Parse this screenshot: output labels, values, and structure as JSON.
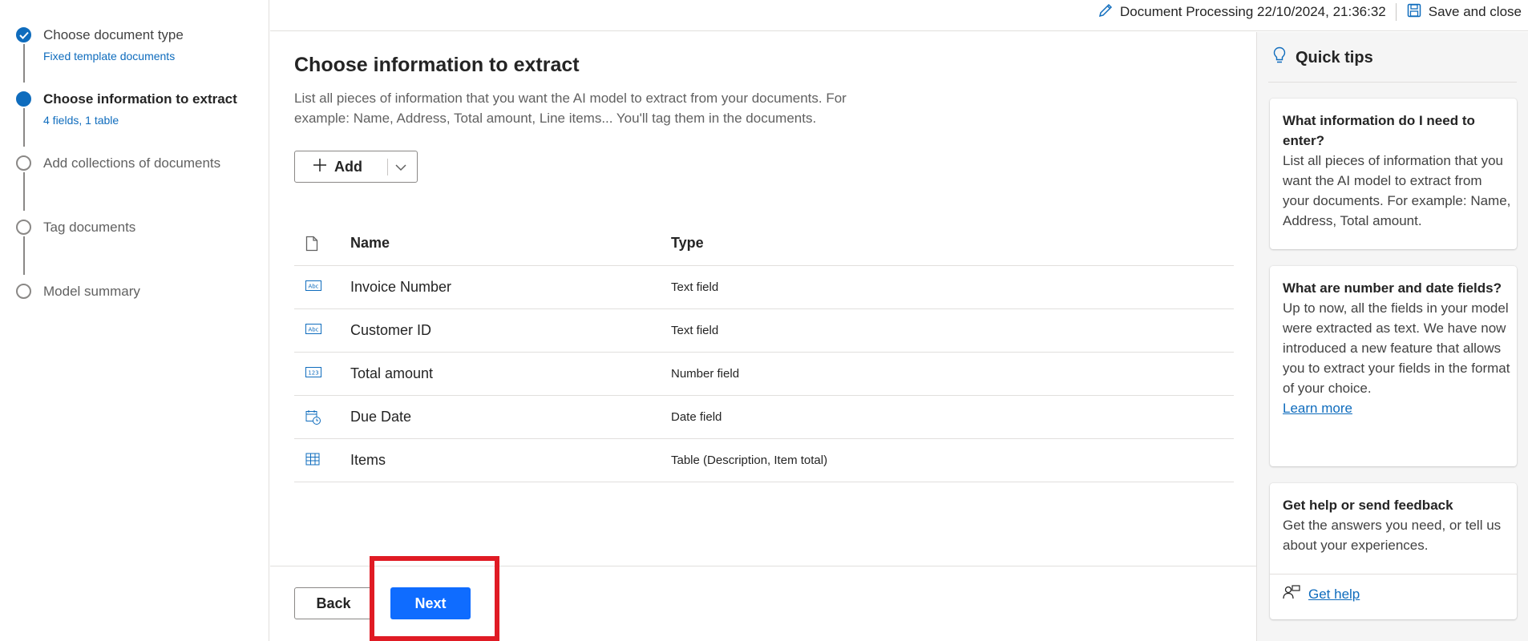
{
  "stepper": {
    "steps": [
      {
        "title": "Choose document type",
        "subtitle": "Fixed template documents",
        "state": "done"
      },
      {
        "title": "Choose information to extract",
        "subtitle": "4 fields, 1 table",
        "state": "current"
      },
      {
        "title": "Add collections of documents",
        "subtitle": "",
        "state": "pending"
      },
      {
        "title": "Tag documents",
        "subtitle": "",
        "state": "pending"
      },
      {
        "title": "Model summary",
        "subtitle": "",
        "state": "pending"
      }
    ]
  },
  "topbar": {
    "doc_title": "Document Processing 22/10/2024, 21:36:32",
    "save_label": "Save and close"
  },
  "main": {
    "title": "Choose information to extract",
    "description": "List all pieces of information that you want the AI model to extract from your documents. For example: Name, Address, Total amount, Line items... You'll tag them in the documents.",
    "add_label": "Add",
    "columns": {
      "name": "Name",
      "type": "Type"
    },
    "rows": [
      {
        "name": "Invoice Number",
        "type": "Text field",
        "icon": "text-field-icon"
      },
      {
        "name": "Customer ID",
        "type": "Text field",
        "icon": "text-field-icon"
      },
      {
        "name": "Total amount",
        "type": "Number field",
        "icon": "number-field-icon"
      },
      {
        "name": "Due Date",
        "type": "Date field",
        "icon": "date-field-icon"
      },
      {
        "name": "Items",
        "type": "Table (Description, Item total)",
        "icon": "table-icon"
      }
    ],
    "back_label": "Back",
    "next_label": "Next"
  },
  "tips": {
    "header": "Quick tips",
    "cards": [
      {
        "title": "What information do I need to enter?",
        "body": "List all pieces of information that you want the AI model to extract from your documents. For example: Name, Address, Total amount."
      },
      {
        "title": "What are number and date fields?",
        "body": "Up to now, all the fields in your model were extracted as text. We have now introduced a new feature that allows you to extract your fields in the format of your choice.",
        "link": "Learn more"
      },
      {
        "title": "Get help or send feedback",
        "body": "Get the answers you need, or tell us about your experiences.",
        "link": "Get help"
      }
    ]
  },
  "colors": {
    "accent": "#0f6cbd",
    "primary_button": "#0f6cff",
    "highlight": "#e01b24"
  }
}
